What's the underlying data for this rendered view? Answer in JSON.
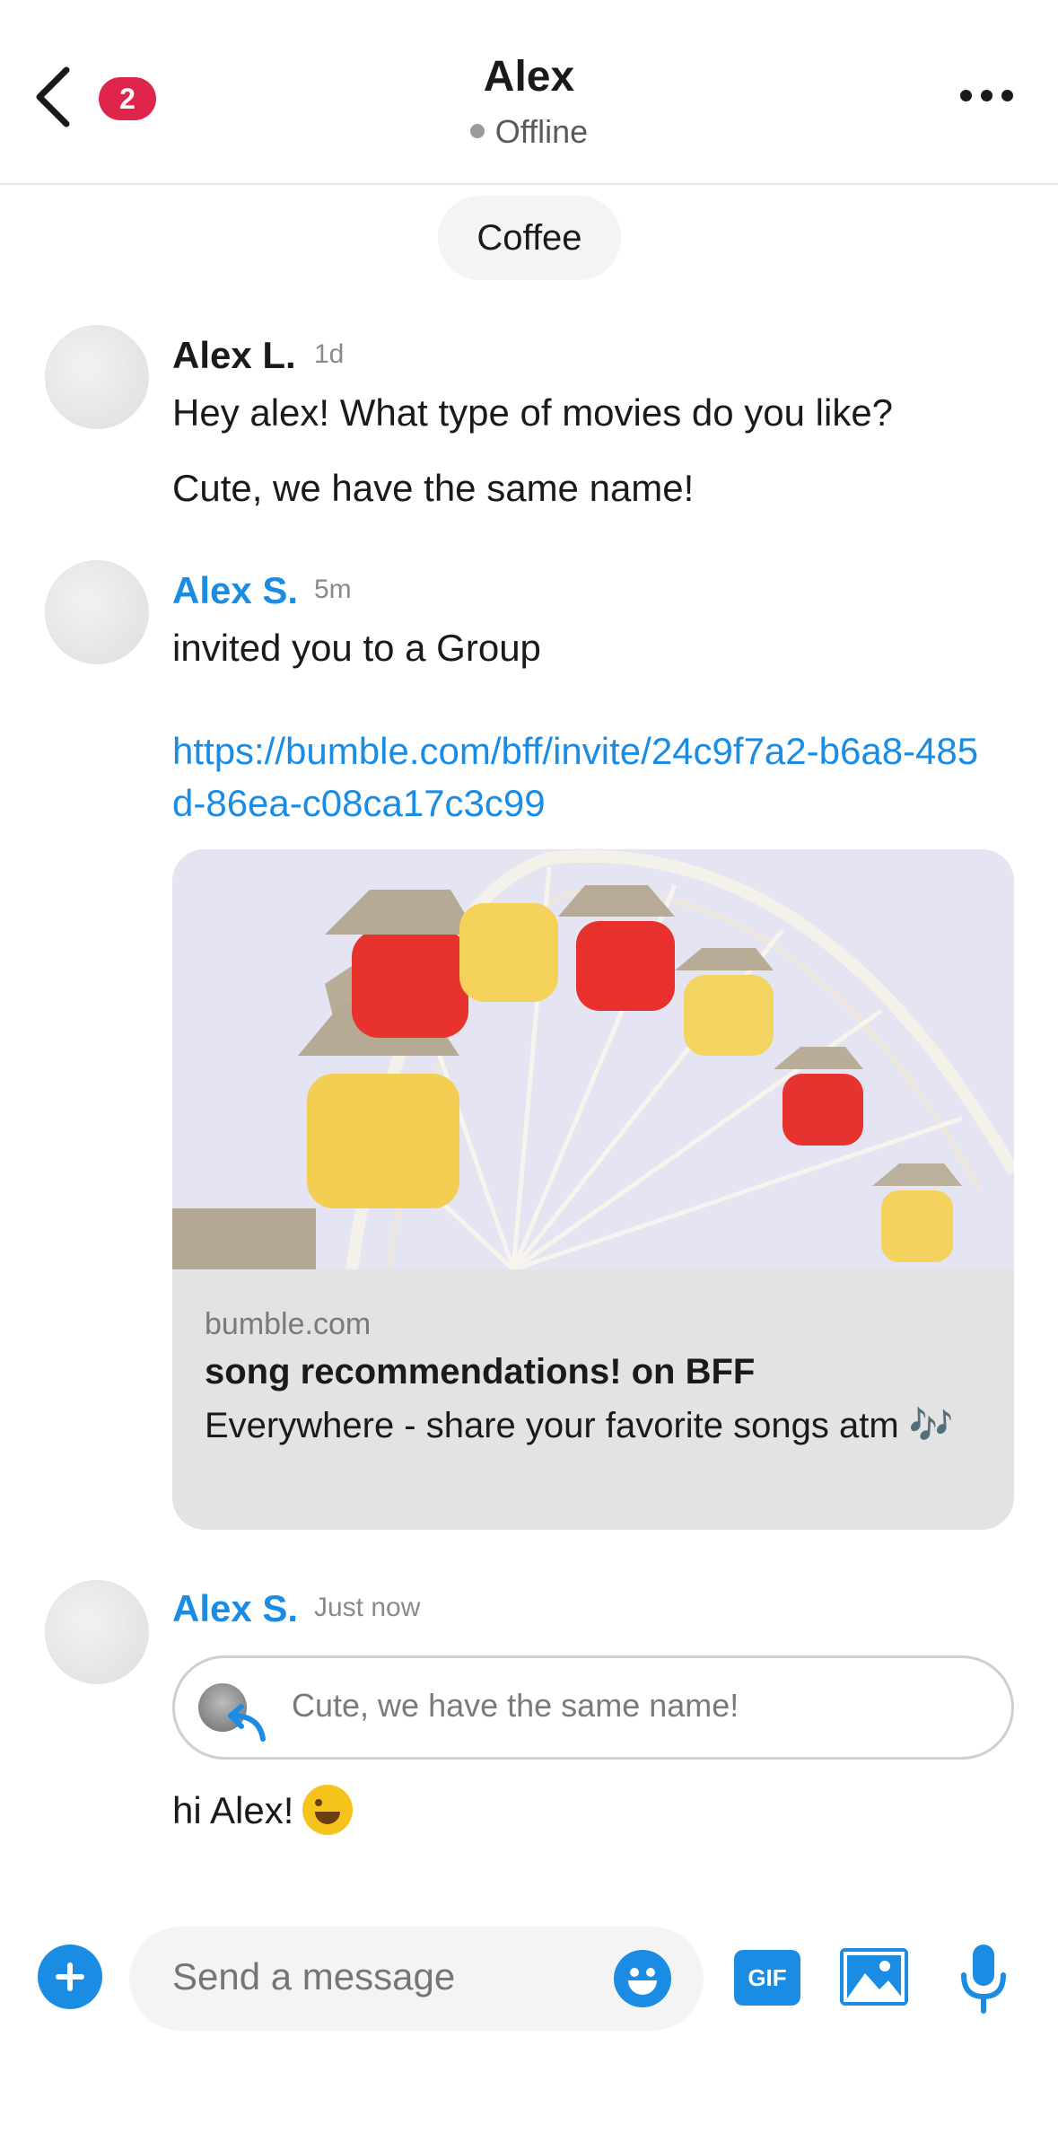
{
  "header": {
    "unread_count": "2",
    "title": "Alex",
    "status": "Offline"
  },
  "topic": "Coffee",
  "messages": [
    {
      "sender": "Alex L.",
      "time": "1d",
      "lines": [
        "Hey alex! What type of movies do you like?",
        "Cute, we have the same name!"
      ]
    },
    {
      "sender": "Alex S.",
      "time": "5m",
      "text": "invited you to a Group",
      "link": "https://bumble.com/bff/invite/24c9f7a2-b6a8-485d-86ea-c08ca17c3c99",
      "card": {
        "domain": "bumble.com",
        "title": "song recommendations! on BFF",
        "description": "Everywhere - share your favorite songs atm 🎶"
      }
    },
    {
      "sender": "Alex S.",
      "time": "Just now",
      "quote": "Cute, we have the same name!",
      "text": "hi Alex!"
    }
  ],
  "composer": {
    "placeholder": "Send a message",
    "gif_label": "GIF"
  },
  "colors": {
    "accent": "#1a8ce4",
    "badge": "#e0254d"
  }
}
